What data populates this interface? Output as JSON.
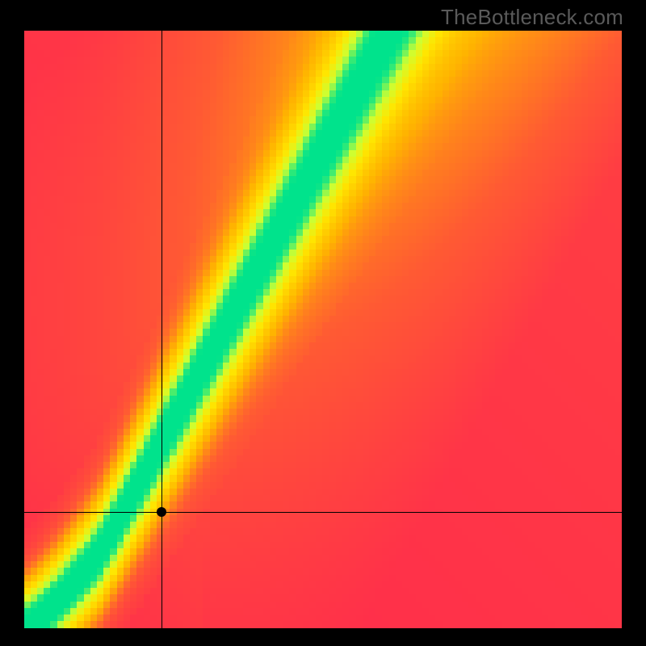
{
  "watermark": "TheBottleneck.com",
  "chart_data": {
    "type": "heatmap",
    "title": "",
    "xlabel": "",
    "ylabel": "",
    "xlim": [
      0,
      1
    ],
    "ylim": [
      0,
      1
    ],
    "grid_resolution": 90,
    "colormap_stops": [
      {
        "t": 0.0,
        "hex": "#ff2a4d"
      },
      {
        "t": 0.25,
        "hex": "#ff5a33"
      },
      {
        "t": 0.5,
        "hex": "#ffb300"
      },
      {
        "t": 0.75,
        "hex": "#ffe600"
      },
      {
        "t": 0.9,
        "hex": "#ccff33"
      },
      {
        "t": 1.0,
        "hex": "#00e38c"
      }
    ],
    "ridge": {
      "comment": "Green band center y as function of x (normalized 0..1). Slight super-linear near origin, ~1.8x slope above break.",
      "break_x": 0.13,
      "low_exp": 1.25,
      "low_scale": 1.0,
      "high_slope": 1.8,
      "band_halfwidth_low": 0.02,
      "band_halfwidth_high": 0.055,
      "falloff_sigma_factor": 4.0
    },
    "background_gradient": {
      "comment": "Broad warm gradient: redder toward lower-left, more orange/yellow toward upper-right independent of ridge.",
      "low": 0.0,
      "high": 0.55
    },
    "crosshair": {
      "x": 0.23,
      "y": 0.195
    },
    "marker": {
      "x": 0.23,
      "y": 0.195
    }
  }
}
